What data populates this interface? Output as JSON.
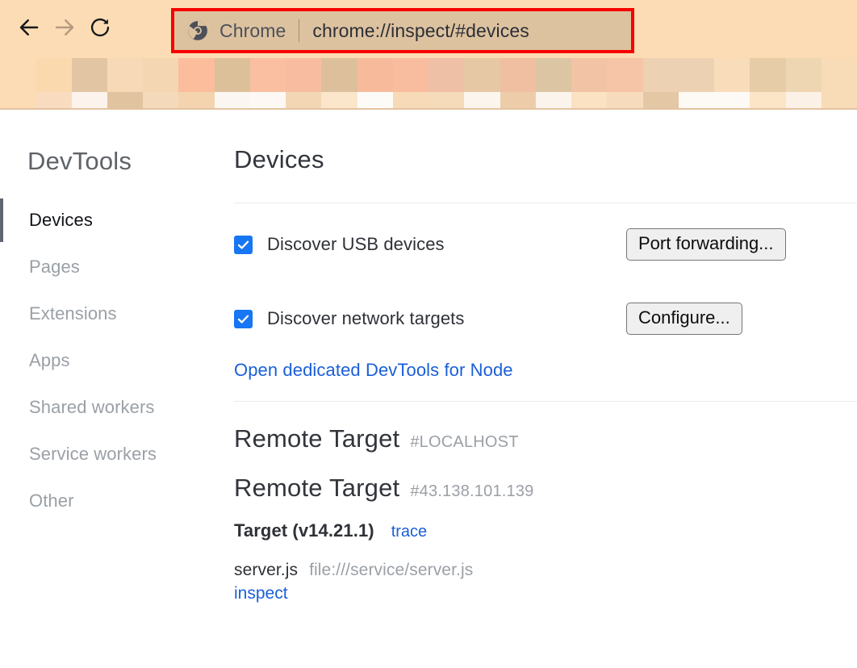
{
  "browser": {
    "back_icon": "arrow-left-icon",
    "forward_icon": "arrow-right-icon",
    "reload_icon": "reload-icon",
    "omnibox": {
      "logo_icon": "chrome-logo-icon",
      "brand": "Chrome",
      "url": "chrome://inspect/#devices",
      "highlight_color": "#f60000"
    },
    "toolbar_bg": "#fcdcb4",
    "omnibox_bg": "#ddc2a0",
    "mosaic": {
      "row1": [
        "#fcdcb4",
        "#fbd9ae",
        "#e2c6a4",
        "#f7d9b7",
        "#f5d6b3",
        "#fbbd9b",
        "#dcc09a",
        "#f9bfa0",
        "#f8bda0",
        "#ddc09b",
        "#f7bb9c",
        "#f8bd9e",
        "#eec0a6",
        "#e6c8a5",
        "#f0bfa2",
        "#dcc5a2",
        "#f2c3a5",
        "#f6c4a7",
        "#ecd2b2",
        "#ecd2b2",
        "#f9dcba",
        "#e7cca8",
        "#efd6b3",
        "#f8dcb8"
      ],
      "row2": [
        "#fcdcb4",
        "#f9dcc0",
        "#fcf3ec",
        "#e2c3a0",
        "#f5d9bb",
        "#f3d4ae",
        "#fbf6f2",
        "#fdf8f3",
        "#f3d7b4",
        "#fbe6cb",
        "#fdfbf8",
        "#f7dab7",
        "#f6dbbb",
        "#fcf5ee",
        "#edcda9",
        "#fbf4ec",
        "#fbe2c3",
        "#f6dcbc",
        "#e4c7a4",
        "#fdf9f5",
        "#fdf9f5",
        "#fce4c6",
        "#fcf1e6",
        "#f8dcb8"
      ]
    }
  },
  "sidebar": {
    "title": "DevTools",
    "items": [
      {
        "label": "Devices",
        "selected": true
      },
      {
        "label": "Pages",
        "selected": false
      },
      {
        "label": "Extensions",
        "selected": false
      },
      {
        "label": "Apps",
        "selected": false
      },
      {
        "label": "Shared workers",
        "selected": false
      },
      {
        "label": "Service workers",
        "selected": false
      },
      {
        "label": "Other",
        "selected": false
      }
    ]
  },
  "main": {
    "heading": "Devices",
    "discover_usb": {
      "label": "Discover USB devices",
      "checked": true,
      "button": "Port forwarding..."
    },
    "discover_network": {
      "label": "Discover network targets",
      "checked": true,
      "button": "Configure..."
    },
    "node_link": "Open dedicated DevTools for Node",
    "remote_targets": [
      {
        "title": "Remote Target",
        "host": "#LOCALHOST",
        "targets": []
      },
      {
        "title": "Remote Target",
        "host": "#43.138.101.139",
        "targets": [
          {
            "name": "Target (v14.21.1)",
            "trace_link": "trace",
            "file_name": "server.js",
            "file_url": "file:///service/server.js",
            "inspect_link": "inspect"
          }
        ]
      }
    ]
  },
  "colors": {
    "accent_blue": "#1a5fd8",
    "checkbox_blue": "#1676f3",
    "muted_gray": "#9aa0a6",
    "text_dark": "#2e3137"
  }
}
